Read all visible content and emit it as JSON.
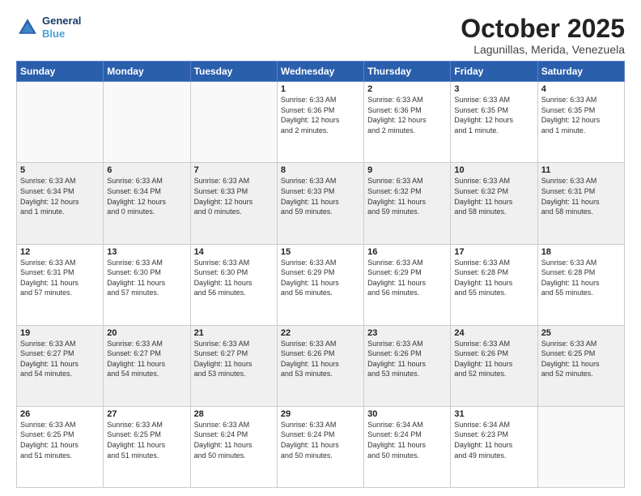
{
  "header": {
    "logo_line1": "General",
    "logo_line2": "Blue",
    "month": "October 2025",
    "location": "Lagunillas, Merida, Venezuela"
  },
  "weekdays": [
    "Sunday",
    "Monday",
    "Tuesday",
    "Wednesday",
    "Thursday",
    "Friday",
    "Saturday"
  ],
  "weeks": [
    [
      {
        "day": "",
        "info": ""
      },
      {
        "day": "",
        "info": ""
      },
      {
        "day": "",
        "info": ""
      },
      {
        "day": "1",
        "info": "Sunrise: 6:33 AM\nSunset: 6:36 PM\nDaylight: 12 hours\nand 2 minutes."
      },
      {
        "day": "2",
        "info": "Sunrise: 6:33 AM\nSunset: 6:36 PM\nDaylight: 12 hours\nand 2 minutes."
      },
      {
        "day": "3",
        "info": "Sunrise: 6:33 AM\nSunset: 6:35 PM\nDaylight: 12 hours\nand 1 minute."
      },
      {
        "day": "4",
        "info": "Sunrise: 6:33 AM\nSunset: 6:35 PM\nDaylight: 12 hours\nand 1 minute."
      }
    ],
    [
      {
        "day": "5",
        "info": "Sunrise: 6:33 AM\nSunset: 6:34 PM\nDaylight: 12 hours\nand 1 minute."
      },
      {
        "day": "6",
        "info": "Sunrise: 6:33 AM\nSunset: 6:34 PM\nDaylight: 12 hours\nand 0 minutes."
      },
      {
        "day": "7",
        "info": "Sunrise: 6:33 AM\nSunset: 6:33 PM\nDaylight: 12 hours\nand 0 minutes."
      },
      {
        "day": "8",
        "info": "Sunrise: 6:33 AM\nSunset: 6:33 PM\nDaylight: 11 hours\nand 59 minutes."
      },
      {
        "day": "9",
        "info": "Sunrise: 6:33 AM\nSunset: 6:32 PM\nDaylight: 11 hours\nand 59 minutes."
      },
      {
        "day": "10",
        "info": "Sunrise: 6:33 AM\nSunset: 6:32 PM\nDaylight: 11 hours\nand 58 minutes."
      },
      {
        "day": "11",
        "info": "Sunrise: 6:33 AM\nSunset: 6:31 PM\nDaylight: 11 hours\nand 58 minutes."
      }
    ],
    [
      {
        "day": "12",
        "info": "Sunrise: 6:33 AM\nSunset: 6:31 PM\nDaylight: 11 hours\nand 57 minutes."
      },
      {
        "day": "13",
        "info": "Sunrise: 6:33 AM\nSunset: 6:30 PM\nDaylight: 11 hours\nand 57 minutes."
      },
      {
        "day": "14",
        "info": "Sunrise: 6:33 AM\nSunset: 6:30 PM\nDaylight: 11 hours\nand 56 minutes."
      },
      {
        "day": "15",
        "info": "Sunrise: 6:33 AM\nSunset: 6:29 PM\nDaylight: 11 hours\nand 56 minutes."
      },
      {
        "day": "16",
        "info": "Sunrise: 6:33 AM\nSunset: 6:29 PM\nDaylight: 11 hours\nand 56 minutes."
      },
      {
        "day": "17",
        "info": "Sunrise: 6:33 AM\nSunset: 6:28 PM\nDaylight: 11 hours\nand 55 minutes."
      },
      {
        "day": "18",
        "info": "Sunrise: 6:33 AM\nSunset: 6:28 PM\nDaylight: 11 hours\nand 55 minutes."
      }
    ],
    [
      {
        "day": "19",
        "info": "Sunrise: 6:33 AM\nSunset: 6:27 PM\nDaylight: 11 hours\nand 54 minutes."
      },
      {
        "day": "20",
        "info": "Sunrise: 6:33 AM\nSunset: 6:27 PM\nDaylight: 11 hours\nand 54 minutes."
      },
      {
        "day": "21",
        "info": "Sunrise: 6:33 AM\nSunset: 6:27 PM\nDaylight: 11 hours\nand 53 minutes."
      },
      {
        "day": "22",
        "info": "Sunrise: 6:33 AM\nSunset: 6:26 PM\nDaylight: 11 hours\nand 53 minutes."
      },
      {
        "day": "23",
        "info": "Sunrise: 6:33 AM\nSunset: 6:26 PM\nDaylight: 11 hours\nand 53 minutes."
      },
      {
        "day": "24",
        "info": "Sunrise: 6:33 AM\nSunset: 6:26 PM\nDaylight: 11 hours\nand 52 minutes."
      },
      {
        "day": "25",
        "info": "Sunrise: 6:33 AM\nSunset: 6:25 PM\nDaylight: 11 hours\nand 52 minutes."
      }
    ],
    [
      {
        "day": "26",
        "info": "Sunrise: 6:33 AM\nSunset: 6:25 PM\nDaylight: 11 hours\nand 51 minutes."
      },
      {
        "day": "27",
        "info": "Sunrise: 6:33 AM\nSunset: 6:25 PM\nDaylight: 11 hours\nand 51 minutes."
      },
      {
        "day": "28",
        "info": "Sunrise: 6:33 AM\nSunset: 6:24 PM\nDaylight: 11 hours\nand 50 minutes."
      },
      {
        "day": "29",
        "info": "Sunrise: 6:33 AM\nSunset: 6:24 PM\nDaylight: 11 hours\nand 50 minutes."
      },
      {
        "day": "30",
        "info": "Sunrise: 6:34 AM\nSunset: 6:24 PM\nDaylight: 11 hours\nand 50 minutes."
      },
      {
        "day": "31",
        "info": "Sunrise: 6:34 AM\nSunset: 6:23 PM\nDaylight: 11 hours\nand 49 minutes."
      },
      {
        "day": "",
        "info": ""
      }
    ]
  ]
}
